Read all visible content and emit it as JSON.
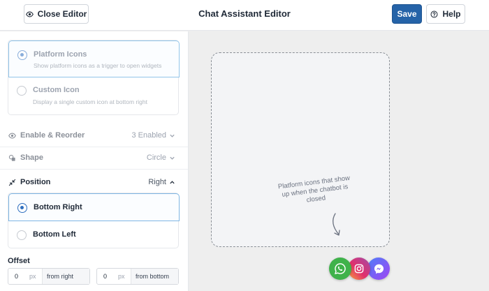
{
  "header": {
    "close_label": "Close Editor",
    "title": "Chat Assistant Editor",
    "save_label": "Save",
    "help_label": "Help"
  },
  "trigger": {
    "options": [
      {
        "title": "Platform Icons",
        "subtitle": "Show platform icons as a trigger to open widgets",
        "selected": true
      },
      {
        "title": "Custom Icon",
        "subtitle": "Display a single custom icon at bottom right",
        "selected": false
      }
    ]
  },
  "settings": {
    "enable_reorder": {
      "label": "Enable & Reorder",
      "value": "3 Enabled"
    },
    "shape": {
      "label": "Shape",
      "value": "Circle"
    },
    "position": {
      "label": "Position",
      "value": "Right"
    }
  },
  "position_options": [
    {
      "label": "Bottom Right",
      "selected": true
    },
    {
      "label": "Bottom Left",
      "selected": false
    }
  ],
  "offset": {
    "label": "Offset",
    "right": {
      "value": "0",
      "unit": "px",
      "suffix": "from right"
    },
    "bottom": {
      "value": "0",
      "unit": "px",
      "suffix": "from bottom"
    }
  },
  "preview": {
    "hint": "Platform icons that show up when the chatbot is closed",
    "icons": [
      "whatsapp-icon",
      "instagram-icon",
      "messenger-icon"
    ]
  },
  "colors": {
    "accent": "#2563a8",
    "whatsapp": "#3fb24a",
    "messenger": "#7b5cf5"
  }
}
